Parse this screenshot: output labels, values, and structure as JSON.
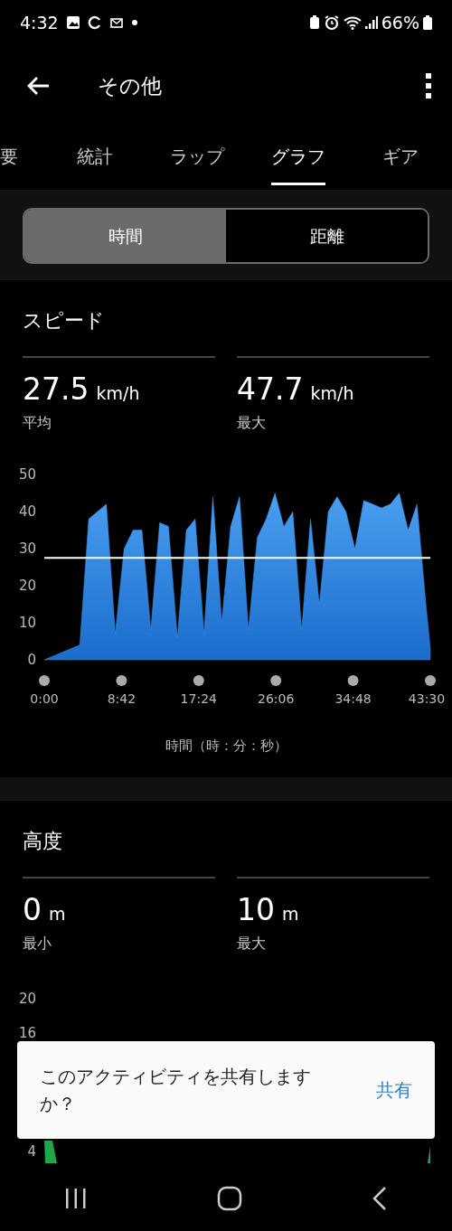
{
  "status_bar": {
    "time": "4:32",
    "battery": "66%"
  },
  "app_bar": {
    "title": "その他"
  },
  "tabs": [
    {
      "label": "要",
      "selected": false
    },
    {
      "label": "統計",
      "selected": false
    },
    {
      "label": "ラップ",
      "selected": false
    },
    {
      "label": "グラフ",
      "selected": true
    },
    {
      "label": "ギア",
      "selected": false
    }
  ],
  "segments": [
    {
      "label": "時間",
      "selected": true
    },
    {
      "label": "距離",
      "selected": false
    }
  ],
  "sections": [
    {
      "title": "スピード",
      "stats": [
        {
          "value": "27.5",
          "unit": "km/h",
          "label": "平均"
        },
        {
          "value": "47.7",
          "unit": "km/h",
          "label": "最大"
        }
      ],
      "chart_data": {
        "type": "area",
        "xlabel": "時間（時：分：秒）",
        "xlim": [
          0,
          43.5
        ],
        "ylim": [
          0,
          50
        ],
        "x": [
          0,
          1,
          2,
          3,
          4,
          5,
          6,
          7,
          8,
          9,
          10,
          11,
          12,
          13,
          14,
          15,
          16,
          17,
          18,
          19,
          20,
          21,
          22,
          23,
          24,
          25,
          26,
          27,
          28,
          29,
          30,
          31,
          32,
          33,
          34,
          35,
          36,
          37,
          38,
          39,
          40,
          41,
          42,
          43,
          43.5
        ],
        "series": [
          {
            "color": "#3f8fe8",
            "values": [
              0,
              1,
              2,
              3,
              4,
              38,
              40,
              42,
              7,
              30,
              35,
              35,
              8,
              37,
              36,
              6,
              35,
              38,
              7,
              44,
              10,
              36,
              44,
              8,
              33,
              38,
              45,
              36,
              40,
              8,
              38,
              15,
              40,
              44,
              40,
              30,
              43,
              42,
              41,
              42,
              45,
              35,
              42,
              15,
              3
            ]
          }
        ],
        "yticks": [
          0,
          10,
          20,
          30,
          40,
          50
        ],
        "xticks": [
          {
            "value": 0,
            "label": "0:00"
          },
          {
            "value": 8.7,
            "label": "8:42"
          },
          {
            "value": 17.4,
            "label": "17:24"
          },
          {
            "value": 26.1,
            "label": "26:06"
          },
          {
            "value": 34.8,
            "label": "34:48"
          },
          {
            "value": 43.5,
            "label": "43:30"
          }
        ],
        "ref_lines": [
          {
            "axis": "y",
            "value": 27.5
          }
        ]
      }
    },
    {
      "title": "高度",
      "stats": [
        {
          "value": "0",
          "unit": "m",
          "label": "最小"
        },
        {
          "value": "10",
          "unit": "m",
          "label": "最大"
        }
      ],
      "axis_labels": [
        "20",
        "16",
        "4"
      ]
    }
  ],
  "snackbar": {
    "message": "このアクティビティを共有しますか？",
    "action": "共有"
  }
}
